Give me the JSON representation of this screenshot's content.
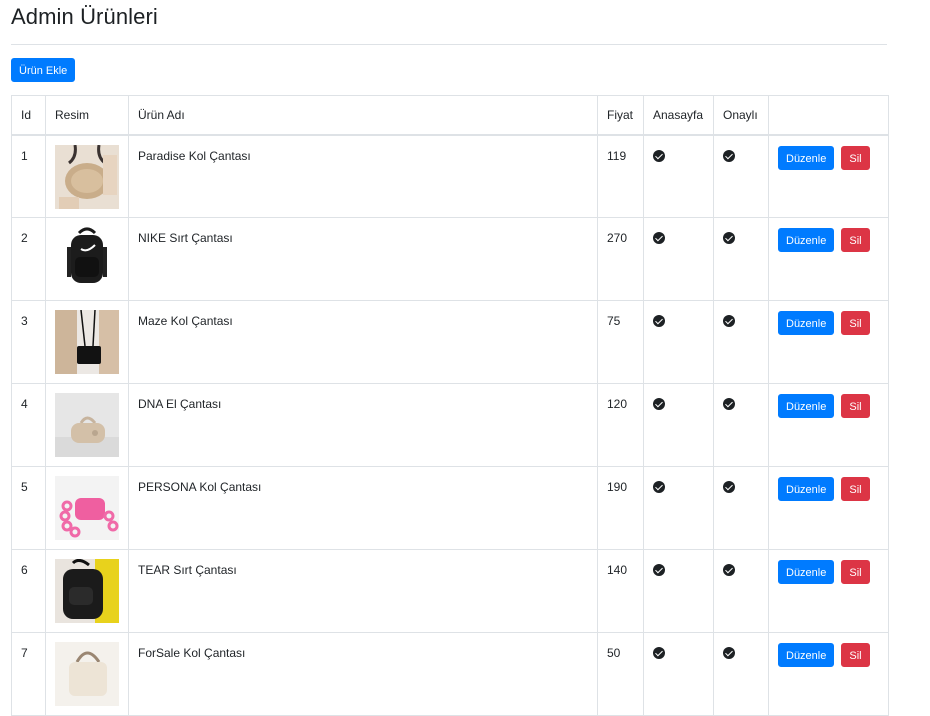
{
  "page": {
    "title": "Admin Ürünleri"
  },
  "toolbar": {
    "add_label": "Ürün Ekle"
  },
  "table": {
    "headers": [
      "Id",
      "Resim",
      "Ürün Adı",
      "Fiyat",
      "Anasayfa",
      "Onaylı",
      ""
    ],
    "edit_label": "Düzenle",
    "delete_label": "Sil",
    "rows": [
      {
        "id": "1",
        "name": "Paradise Kol Çantası",
        "price": "119",
        "homepage": true,
        "approved": true,
        "image": "beige-round-bag"
      },
      {
        "id": "2",
        "name": "NIKE Sırt Çantası",
        "price": "270",
        "homepage": true,
        "approved": true,
        "image": "black-backpack"
      },
      {
        "id": "3",
        "name": "Maze Kol Çantası",
        "price": "75",
        "homepage": true,
        "approved": true,
        "image": "black-shoulder-bag"
      },
      {
        "id": "4",
        "name": "DNA El Çantası",
        "price": "120",
        "homepage": true,
        "approved": true,
        "image": "beige-hand-bag"
      },
      {
        "id": "5",
        "name": "PERSONA Kol Çantası",
        "price": "190",
        "homepage": true,
        "approved": true,
        "image": "pink-chain-bag"
      },
      {
        "id": "6",
        "name": "TEAR Sırt Çantası",
        "price": "140",
        "homepage": true,
        "approved": true,
        "image": "black-yellow-backpack"
      },
      {
        "id": "7",
        "name": "ForSale Kol Çantası",
        "price": "50",
        "homepage": true,
        "approved": true,
        "image": "cream-bag"
      }
    ]
  },
  "colors": {
    "primary": "#007bff",
    "danger": "#dc3545",
    "border": "#dee2e6",
    "text": "#212529"
  }
}
